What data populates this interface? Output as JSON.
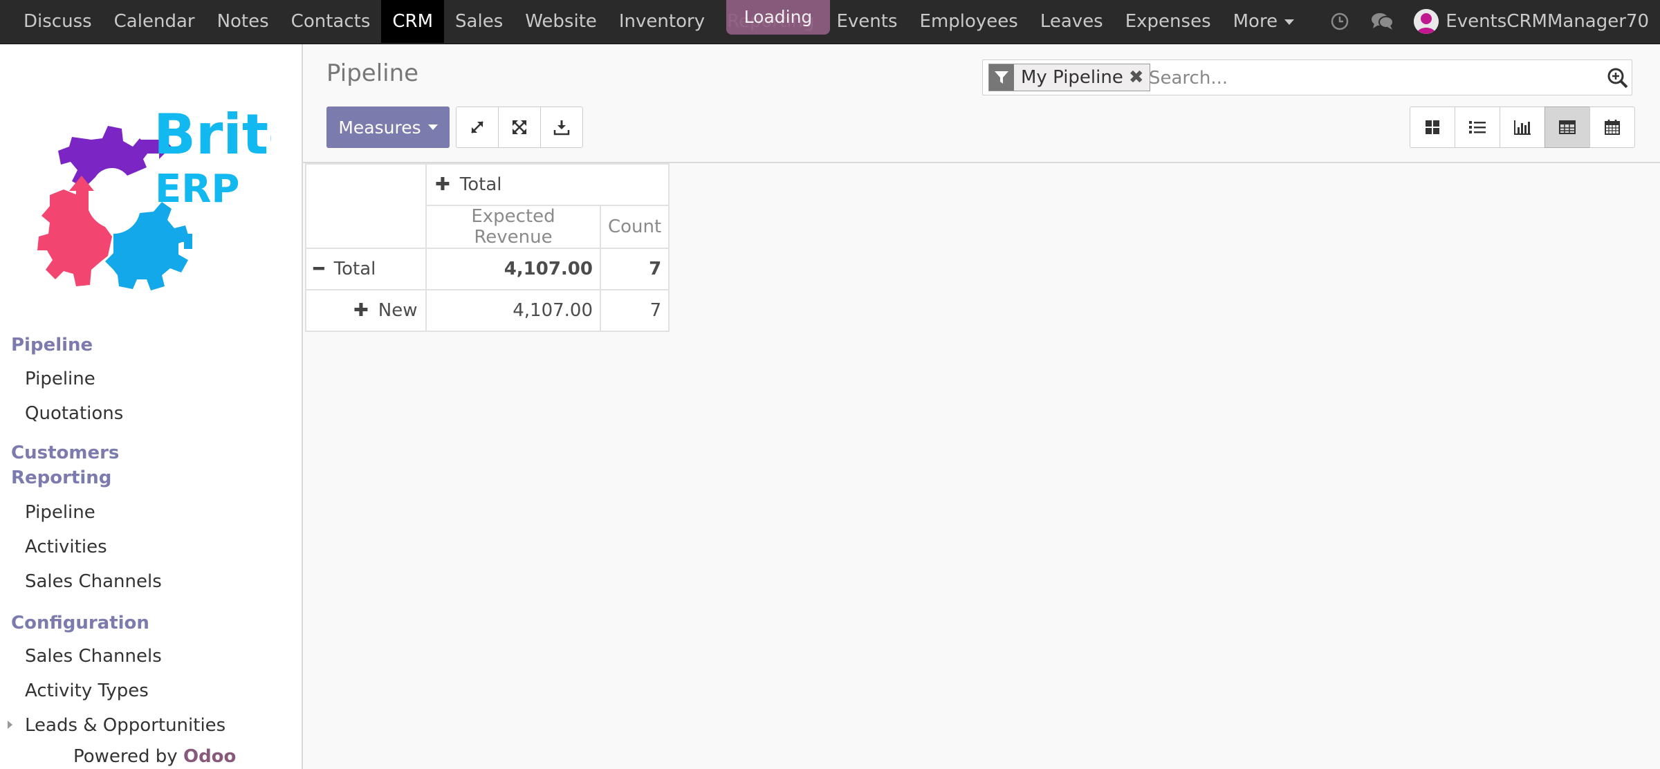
{
  "navbar": {
    "menus": [
      "Discuss",
      "Calendar",
      "Notes",
      "Contacts",
      "CRM",
      "Sales",
      "Website",
      "Inventory",
      "Reporting",
      "Events",
      "Employees",
      "Leaves",
      "Expenses"
    ],
    "active": "CRM",
    "more_label": "More",
    "loading_label": "Loading",
    "user_name": "EventsCRMManager70"
  },
  "sidebar": {
    "logo_word1": "Brite",
    "logo_word2": "ERP",
    "sections": [
      {
        "title": "Pipeline",
        "items": [
          "Pipeline",
          "Quotations"
        ]
      },
      {
        "title": "Customers",
        "items": []
      },
      {
        "title": "Reporting",
        "items": [
          "Pipeline",
          "Activities",
          "Sales Channels"
        ]
      },
      {
        "title": "Configuration",
        "items": [
          "Sales Channels",
          "Activity Types",
          "Leads & Opportunities"
        ]
      }
    ],
    "powered_prefix": "Powered by ",
    "powered_brand": "Odoo"
  },
  "control_panel": {
    "title": "Pipeline",
    "facet_label": "My Pipeline",
    "facet_remove": "✖",
    "search_placeholder": "Search...",
    "measures_label": "Measures"
  },
  "pivot": {
    "col_header": "Total",
    "measures": [
      "Expected Revenue",
      "Count"
    ],
    "rows": [
      {
        "label": "Total",
        "expected_revenue": "4,107.00",
        "count": "7"
      },
      {
        "label": "New",
        "expected_revenue": "4,107.00",
        "count": "7"
      }
    ]
  },
  "colors": {
    "accent": "#7c7bad",
    "brand": "#875a7b",
    "navbar": "#2a2a2a"
  },
  "icons": [
    "clock-icon",
    "chat-icon",
    "filter-icon",
    "search-icon",
    "expand-icon",
    "flip-axis-icon",
    "download-icon",
    "kanban-icon",
    "list-icon",
    "graph-icon",
    "pivot-icon",
    "calendar-icon"
  ]
}
